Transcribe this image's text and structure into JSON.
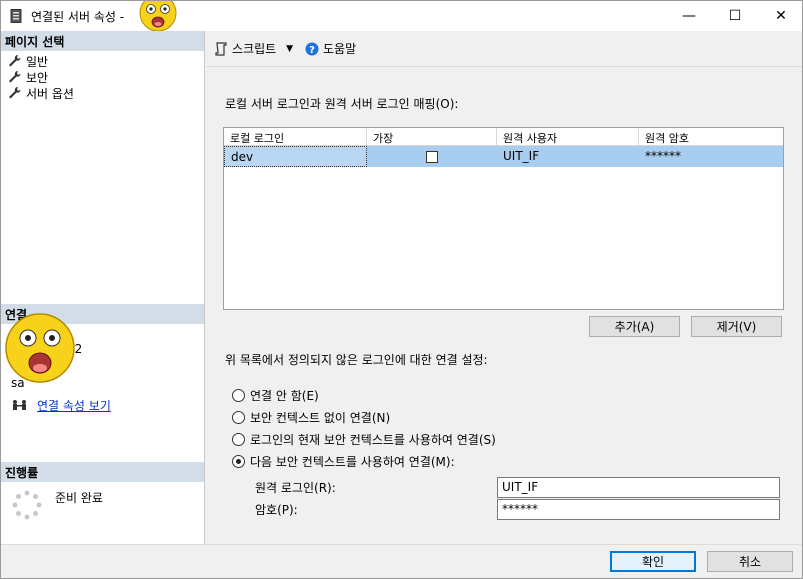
{
  "window": {
    "title": "연결된 서버 속성 -",
    "minimize": "—",
    "maximize": "☐",
    "close": "✕"
  },
  "left": {
    "page_select_header": "페이지 선택",
    "pages": [
      {
        "label": "일반"
      },
      {
        "label": "보안"
      },
      {
        "label": "서버 옵션"
      }
    ],
    "connection_header": "연결",
    "connection_partial_1": "52",
    "connection_partial_2": "sa",
    "connection_link": "연결 속성 보기",
    "progress_header": "진행률",
    "progress_status": "준비 완료"
  },
  "toolbar": {
    "script_label": "스크립트",
    "help_label": "도움말"
  },
  "main": {
    "mapping_label": "로컬 서버 로그인과 원격 서버 로그인 매핑(O):",
    "columns": [
      "로컬 로그인",
      "가장",
      "원격 사용자",
      "원격 암호"
    ],
    "rows": [
      {
        "local_login": "dev",
        "impersonate": false,
        "remote_user": "UIT_IF",
        "remote_password": "******"
      }
    ],
    "add_button": "추가(A)",
    "remove_button": "제거(V)",
    "undefined_label": "위 목록에서 정의되지 않은 로그인에 대한 연결 설정:",
    "options": [
      {
        "label": "연결 안 함(E)",
        "selected": false
      },
      {
        "label": "보안 컨텍스트 없이 연결(N)",
        "selected": false
      },
      {
        "label": "로그인의 현재 보안 컨텍스트를 사용하여 연결(S)",
        "selected": false
      },
      {
        "label": "다음 보안 컨텍스트를 사용하여 연결(M):",
        "selected": true
      }
    ],
    "remote_login_label": "원격 로그인(R):",
    "remote_login_value": "UIT_IF",
    "password_label": "암호(P):",
    "password_value": "******"
  },
  "footer": {
    "ok_button": "확인",
    "cancel_button": "취소"
  }
}
